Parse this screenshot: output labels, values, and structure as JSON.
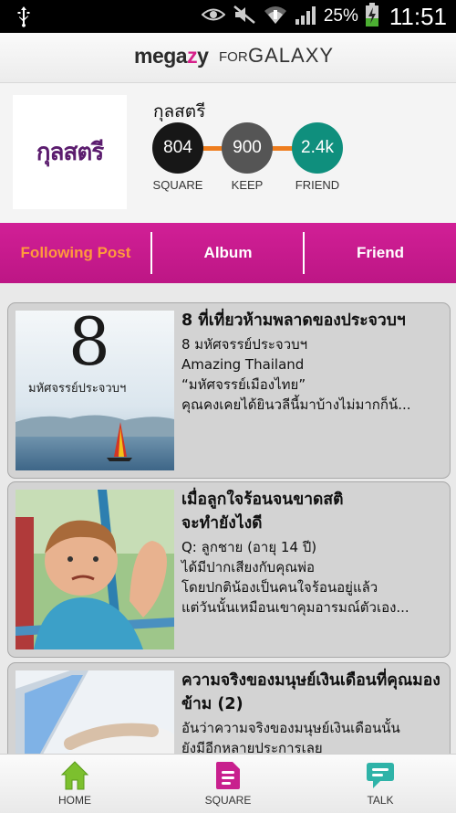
{
  "status_bar": {
    "battery_percent": "25%",
    "time": "11:51",
    "icons": [
      "usb-icon",
      "eye-icon",
      "mute-icon",
      "wifi-icon",
      "signal-icon",
      "battery-charging-icon"
    ]
  },
  "app_bar": {
    "brand": "megazy",
    "brand_prefix": "mega",
    "brand_z": "z",
    "brand_suffix": "y",
    "for_text": "FOR",
    "galaxy_text": "GALAXY"
  },
  "profile": {
    "logo_text": "กุลสตรี",
    "name": "กุลสตรี",
    "stats": [
      {
        "value": "804",
        "label": "SQUARE",
        "color": "#171717"
      },
      {
        "value": "900",
        "label": "KEEP",
        "color": "#555555"
      },
      {
        "value": "2.4k",
        "label": "FRIEND",
        "color": "#0f8f7d"
      }
    ],
    "connector_color": "#ee7d1e"
  },
  "tabs": [
    {
      "label": "Following Post",
      "active": true
    },
    {
      "label": "Album",
      "active": false
    },
    {
      "label": "Friend",
      "active": false
    }
  ],
  "colors": {
    "tab_bg": "#c91a8f",
    "tab_active_text": "#ff9a3c",
    "card_bg": "#d3d3d3"
  },
  "posts": [
    {
      "title": "8 ที่เที่ยวห้ามพลาดของประจวบฯ",
      "body": "8 มหัศจรรย์ประจวบฯ\nAmazing Thailand\n“มหัศจรรย์เมืองไทย”\nคุณคงเคยได้ยินวลีนี้มาบ้างไม่มากก็น้...",
      "thumb_caption": "มหัศจรรย์ประจวบฯ",
      "thumb_numeral": "8"
    },
    {
      "title": "เมื่อลูกใจร้อนจนขาดสติ\nจะทำยังไงดี",
      "body": "Q: ลูกชาย (อายุ 14 ปี)\nได้มีปากเสียงกับคุณพ่อ\nโดยปกติน้องเป็นคนใจร้อนอยู่แล้ว\nแต่วันนั้นเหมือนเขาคุมอารมณ์ตัวเอง..."
    },
    {
      "title": "ความจริงของมนุษย์เงินเดือนที่คุณมองข้าม (2)",
      "body": "อันว่าความจริงของมนุษย์เงินเดือนนั้น\nยังมีอีกหลายประการเลย"
    }
  ],
  "bottom_nav": [
    {
      "label": "HOME",
      "icon": "home-icon"
    },
    {
      "label": "SQUARE",
      "icon": "square-icon"
    },
    {
      "label": "TALK",
      "icon": "talk-icon"
    }
  ]
}
